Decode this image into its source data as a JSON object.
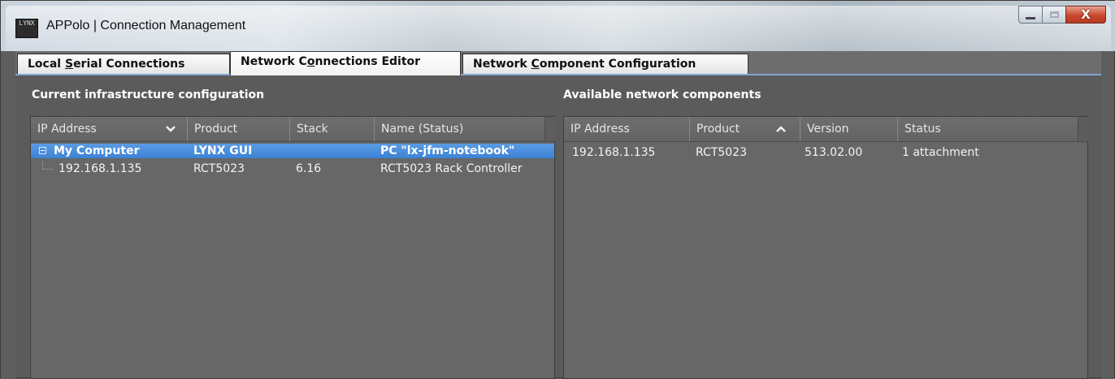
{
  "window": {
    "title": "APPolo | Connection Management",
    "app_icon_text": "LYNX",
    "close_glyph": "X"
  },
  "tabs": [
    {
      "pre": "Local ",
      "u": "S",
      "post": "erial Connections",
      "active": false
    },
    {
      "pre": "Network C",
      "u": "o",
      "post": "nnections Editor",
      "active": true
    },
    {
      "pre": "Network ",
      "u": "C",
      "post": "omponent Configuration",
      "active": false
    }
  ],
  "left_panel": {
    "title": "Current infrastructure configuration",
    "columns": [
      "IP Address",
      "Product",
      "Stack",
      "Name (Status)"
    ],
    "rows": [
      {
        "ip": "My Computer",
        "product": "LYNX GUI",
        "stack": "",
        "name": "PC \"lx-jfm-notebook\"",
        "selected": true
      },
      {
        "ip": "192.168.1.135",
        "product": "RCT5023",
        "stack": "6.16",
        "name": "RCT5023 Rack Controller",
        "selected": false
      }
    ]
  },
  "right_panel": {
    "title": "Available network components",
    "columns": [
      "IP Address",
      "Product",
      "Version",
      "Status"
    ],
    "rows": [
      {
        "ip": "192.168.1.135",
        "product": "RCT5023",
        "version": "513.02.00",
        "status": "1 attachment"
      }
    ]
  },
  "colors": {
    "selection": "#3c82d6",
    "background": "#5b5b5b",
    "tab_underline": "#7fa6d6"
  }
}
